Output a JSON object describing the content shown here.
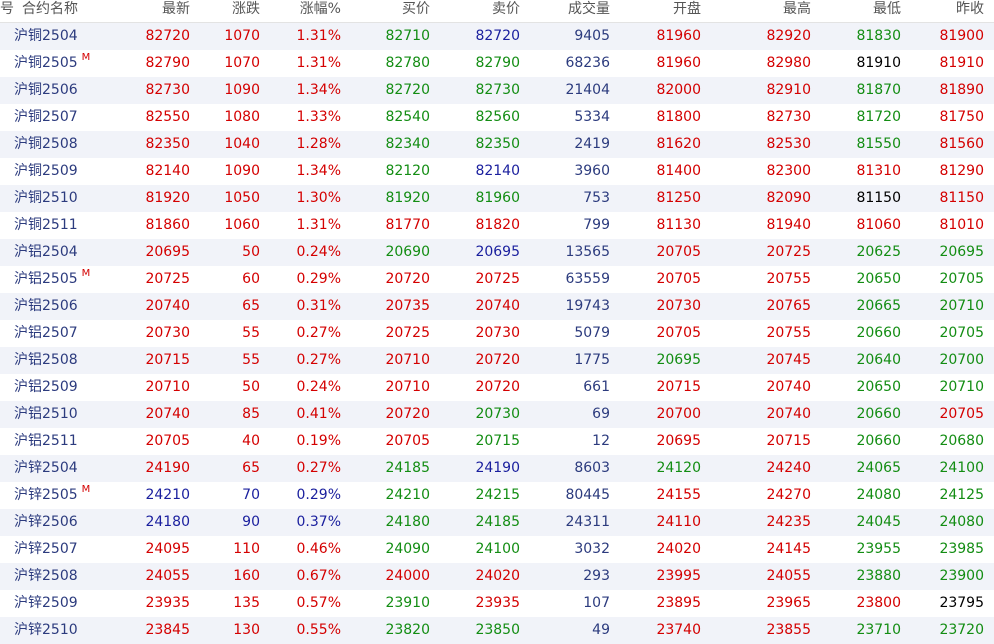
{
  "colors": {
    "up": "#d40000",
    "down": "#138d13",
    "blue": "#1a1f9e",
    "black": "#000000",
    "volume": "#2c3b7e",
    "name": "#2c3b7e"
  },
  "header": [
    "号",
    "合约名称",
    "最新",
    "涨跌",
    "涨幅%",
    "买价",
    "卖价",
    "成交量",
    "开盘",
    "最高",
    "最低",
    "昨收"
  ],
  "rows": [
    {
      "name": "沪铜2504",
      "mark": "",
      "last": "82720",
      "chg": "1070",
      "pct": "1.31%",
      "bid": "82710",
      "ask": "82720",
      "vol": "9405",
      "open": "81960",
      "high": "82920",
      "low": "81830",
      "prev": "81900",
      "cl": "up",
      "cc": "up",
      "cb": "down",
      "ca": "blue",
      "co": "up",
      "ch": "up",
      "cw": "up"
    },
    {
      "name": "沪铜2505",
      "mark": "M",
      "last": "82790",
      "chg": "1070",
      "pct": "1.31%",
      "bid": "82780",
      "ask": "82790",
      "vol": "68236",
      "open": "81960",
      "high": "82980",
      "low": "81910",
      "prev": "81910",
      "cl": "up",
      "cc": "up",
      "cb": "down",
      "ca": "down",
      "co": "up",
      "ch": "up",
      "cw": "up"
    },
    {
      "name": "沪铜2506",
      "mark": "",
      "last": "82730",
      "chg": "1090",
      "pct": "1.34%",
      "bid": "82720",
      "ask": "82730",
      "vol": "21404",
      "open": "82000",
      "high": "82910",
      "low": "81870",
      "prev": "81890",
      "cl": "up",
      "cc": "up",
      "cb": "down",
      "ca": "down",
      "co": "up",
      "ch": "up",
      "cw": "up"
    },
    {
      "name": "沪铜2507",
      "mark": "",
      "last": "82550",
      "chg": "1080",
      "pct": "1.33%",
      "bid": "82540",
      "ask": "82560",
      "vol": "5334",
      "open": "81800",
      "high": "82730",
      "low": "81720",
      "prev": "81750",
      "cl": "up",
      "cc": "up",
      "cb": "down",
      "ca": "down",
      "co": "up",
      "ch": "up",
      "cw": "up"
    },
    {
      "name": "沪铜2508",
      "mark": "",
      "last": "82350",
      "chg": "1040",
      "pct": "1.28%",
      "bid": "82340",
      "ask": "82350",
      "vol": "2419",
      "open": "81620",
      "high": "82530",
      "low": "81550",
      "prev": "81560",
      "cl": "up",
      "cc": "up",
      "cb": "down",
      "ca": "down",
      "co": "up",
      "ch": "up",
      "cw": "up"
    },
    {
      "name": "沪铜2509",
      "mark": "",
      "last": "82140",
      "chg": "1090",
      "pct": "1.34%",
      "bid": "82120",
      "ask": "82140",
      "vol": "3960",
      "open": "81400",
      "high": "82300",
      "low": "81310",
      "prev": "81290",
      "cl": "up",
      "cc": "up",
      "cb": "down",
      "ca": "blue",
      "co": "up",
      "ch": "up",
      "cw": "up"
    },
    {
      "name": "沪铜2510",
      "mark": "",
      "last": "81920",
      "chg": "1050",
      "pct": "1.30%",
      "bid": "81920",
      "ask": "81960",
      "vol": "753",
      "open": "81250",
      "high": "82090",
      "low": "81150",
      "prev": "81150",
      "cl": "up",
      "cc": "up",
      "cb": "down",
      "ca": "down",
      "co": "up",
      "ch": "up",
      "cw": "up"
    },
    {
      "name": "沪铜2511",
      "mark": "",
      "last": "81860",
      "chg": "1060",
      "pct": "1.31%",
      "bid": "81770",
      "ask": "81820",
      "vol": "799",
      "open": "81130",
      "high": "81940",
      "low": "81060",
      "prev": "81010",
      "cl": "up",
      "cc": "up",
      "cb": "up",
      "ca": "up",
      "co": "up",
      "ch": "up",
      "cw": "up"
    },
    {
      "name": "沪铝2504",
      "mark": "",
      "last": "20695",
      "chg": "50",
      "pct": "0.24%",
      "bid": "20690",
      "ask": "20695",
      "vol": "13565",
      "open": "20705",
      "high": "20725",
      "low": "20625",
      "prev": "20695",
      "cl": "up",
      "cc": "up",
      "cb": "down",
      "ca": "blue",
      "co": "up",
      "ch": "up",
      "cw": "down"
    },
    {
      "name": "沪铝2505",
      "mark": "M",
      "last": "20725",
      "chg": "60",
      "pct": "0.29%",
      "bid": "20720",
      "ask": "20725",
      "vol": "63559",
      "open": "20705",
      "high": "20755",
      "low": "20650",
      "prev": "20705",
      "cl": "up",
      "cc": "up",
      "cb": "up",
      "ca": "up",
      "co": "up",
      "ch": "up",
      "cw": "down"
    },
    {
      "name": "沪铝2506",
      "mark": "",
      "last": "20740",
      "chg": "65",
      "pct": "0.31%",
      "bid": "20735",
      "ask": "20740",
      "vol": "19743",
      "open": "20730",
      "high": "20765",
      "low": "20665",
      "prev": "20710",
      "cl": "up",
      "cc": "up",
      "cb": "up",
      "ca": "up",
      "co": "up",
      "ch": "up",
      "cw": "down"
    },
    {
      "name": "沪铝2507",
      "mark": "",
      "last": "20730",
      "chg": "55",
      "pct": "0.27%",
      "bid": "20725",
      "ask": "20730",
      "vol": "5079",
      "open": "20705",
      "high": "20755",
      "low": "20660",
      "prev": "20705",
      "cl": "up",
      "cc": "up",
      "cb": "up",
      "ca": "up",
      "co": "up",
      "ch": "up",
      "cw": "down"
    },
    {
      "name": "沪铝2508",
      "mark": "",
      "last": "20715",
      "chg": "55",
      "pct": "0.27%",
      "bid": "20710",
      "ask": "20720",
      "vol": "1775",
      "open": "20695",
      "high": "20745",
      "low": "20640",
      "prev": "20700",
      "cl": "up",
      "cc": "up",
      "cb": "up",
      "ca": "up",
      "co": "down",
      "ch": "up",
      "cw": "down"
    },
    {
      "name": "沪铝2509",
      "mark": "",
      "last": "20710",
      "chg": "50",
      "pct": "0.24%",
      "bid": "20710",
      "ask": "20720",
      "vol": "661",
      "open": "20715",
      "high": "20740",
      "low": "20650",
      "prev": "20710",
      "cl": "up",
      "cc": "up",
      "cb": "up",
      "ca": "up",
      "co": "up",
      "ch": "up",
      "cw": "down"
    },
    {
      "name": "沪铝2510",
      "mark": "",
      "last": "20740",
      "chg": "85",
      "pct": "0.41%",
      "bid": "20720",
      "ask": "20730",
      "vol": "69",
      "open": "20700",
      "high": "20740",
      "low": "20660",
      "prev": "20705",
      "cl": "up",
      "cc": "up",
      "cb": "up",
      "ca": "down",
      "co": "up",
      "ch": "up",
      "cw": "up"
    },
    {
      "name": "沪铝2511",
      "mark": "",
      "last": "20705",
      "chg": "40",
      "pct": "0.19%",
      "bid": "20705",
      "ask": "20715",
      "vol": "12",
      "open": "20695",
      "high": "20715",
      "low": "20660",
      "prev": "20680",
      "cl": "up",
      "cc": "up",
      "cb": "up",
      "ca": "down",
      "co": "up",
      "ch": "up",
      "cw": "down"
    },
    {
      "name": "沪锌2504",
      "mark": "",
      "last": "24190",
      "chg": "65",
      "pct": "0.27%",
      "bid": "24185",
      "ask": "24190",
      "vol": "8603",
      "open": "24120",
      "high": "24240",
      "low": "24065",
      "prev": "24100",
      "cl": "up",
      "cc": "up",
      "cb": "down",
      "ca": "blue",
      "co": "down",
      "ch": "up",
      "cw": "down"
    },
    {
      "name": "沪锌2505",
      "mark": "M",
      "last": "24210",
      "chg": "70",
      "pct": "0.29%",
      "bid": "24210",
      "ask": "24215",
      "vol": "80445",
      "open": "24155",
      "high": "24270",
      "low": "24080",
      "prev": "24125",
      "cl": "blue",
      "cc": "blue",
      "cb": "down",
      "ca": "down",
      "co": "up",
      "ch": "up",
      "cw": "down"
    },
    {
      "name": "沪锌2506",
      "mark": "",
      "last": "24180",
      "chg": "90",
      "pct": "0.37%",
      "bid": "24180",
      "ask": "24185",
      "vol": "24311",
      "open": "24110",
      "high": "24235",
      "low": "24045",
      "prev": "24080",
      "cl": "blue",
      "cc": "blue",
      "cb": "down",
      "ca": "down",
      "co": "up",
      "ch": "up",
      "cw": "down"
    },
    {
      "name": "沪锌2507",
      "mark": "",
      "last": "24095",
      "chg": "110",
      "pct": "0.46%",
      "bid": "24090",
      "ask": "24100",
      "vol": "3032",
      "open": "24020",
      "high": "24145",
      "low": "23955",
      "prev": "23985",
      "cl": "up",
      "cc": "up",
      "cb": "down",
      "ca": "down",
      "co": "up",
      "ch": "up",
      "cw": "down"
    },
    {
      "name": "沪锌2508",
      "mark": "",
      "last": "24055",
      "chg": "160",
      "pct": "0.67%",
      "bid": "24000",
      "ask": "24020",
      "vol": "293",
      "open": "23995",
      "high": "24055",
      "low": "23880",
      "prev": "23900",
      "cl": "up",
      "cc": "up",
      "cb": "up",
      "ca": "up",
      "co": "up",
      "ch": "up",
      "cw": "down"
    },
    {
      "name": "沪锌2509",
      "mark": "",
      "last": "23935",
      "chg": "135",
      "pct": "0.57%",
      "bid": "23910",
      "ask": "23935",
      "vol": "107",
      "open": "23895",
      "high": "23965",
      "low": "23800",
      "prev": "23795",
      "cl": "up",
      "cc": "up",
      "cb": "down",
      "ca": "up",
      "co": "up",
      "ch": "up",
      "cw": "black"
    },
    {
      "name": "沪锌2510",
      "mark": "",
      "last": "23845",
      "chg": "130",
      "pct": "0.55%",
      "bid": "23820",
      "ask": "23850",
      "vol": "49",
      "open": "23740",
      "high": "23855",
      "low": "23710",
      "prev": "23720",
      "cl": "up",
      "cc": "up",
      "cb": "down",
      "ca": "down",
      "co": "up",
      "ch": "up",
      "cw": "down"
    }
  ]
}
